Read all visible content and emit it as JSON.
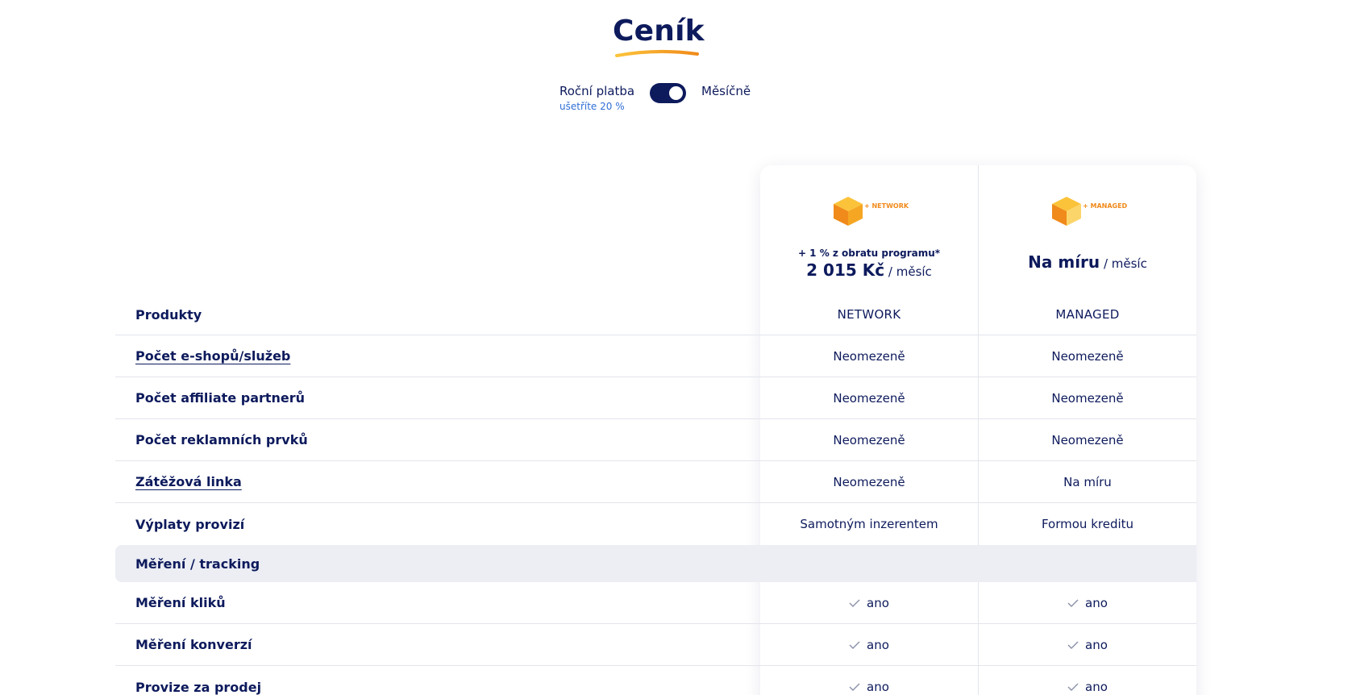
{
  "header": {
    "title": "Ceník",
    "billing": {
      "yearly_label": "Roční platba",
      "yearly_note": "ušetříte 20 %",
      "monthly_label": "Měsíčně"
    }
  },
  "plans": [
    {
      "logo_text": "+ NETWORK",
      "note": "+ 1 % z obratu programu*",
      "price": "2 015 Kč",
      "period": "/ měsíc",
      "name": "NETWORK"
    },
    {
      "logo_text": "+ MANAGED",
      "note": "",
      "price": "Na míru",
      "period": "/ měsíc",
      "name": "MANAGED"
    }
  ],
  "table": {
    "products_label": "Produkty",
    "rows": [
      {
        "feature": "Počet e-shopů/služeb",
        "network": "Neomezeně",
        "managed": "Neomezeně"
      },
      {
        "feature": "Počet affiliate partnerů",
        "network": "Neomezeně",
        "managed": "Neomezeně"
      },
      {
        "feature": "Počet reklamních prvků",
        "network": "Neomezeně",
        "managed": "Neomezeně"
      },
      {
        "feature": "Zátěžová linka",
        "network": "Neomezeně",
        "managed": "Na míru"
      },
      {
        "feature": "Výplaty provizí",
        "network": "Samotným inzerentem",
        "managed": "Formou kreditu"
      }
    ],
    "section_title": "Měření / tracking",
    "tracking_rows": [
      {
        "feature": "Měření kliků",
        "network": "ano",
        "managed": "ano"
      },
      {
        "feature": "Měření konverzí",
        "network": "ano",
        "managed": "ano"
      },
      {
        "feature": "Provize za prodej",
        "network": "ano",
        "managed": "ano"
      }
    ]
  },
  "colors": {
    "navy": "#0d1a5c",
    "accent_blue": "#2f6fd6",
    "orange": "#f08a1a",
    "yellow": "#fbc33a",
    "section_bg": "#eceef4"
  }
}
